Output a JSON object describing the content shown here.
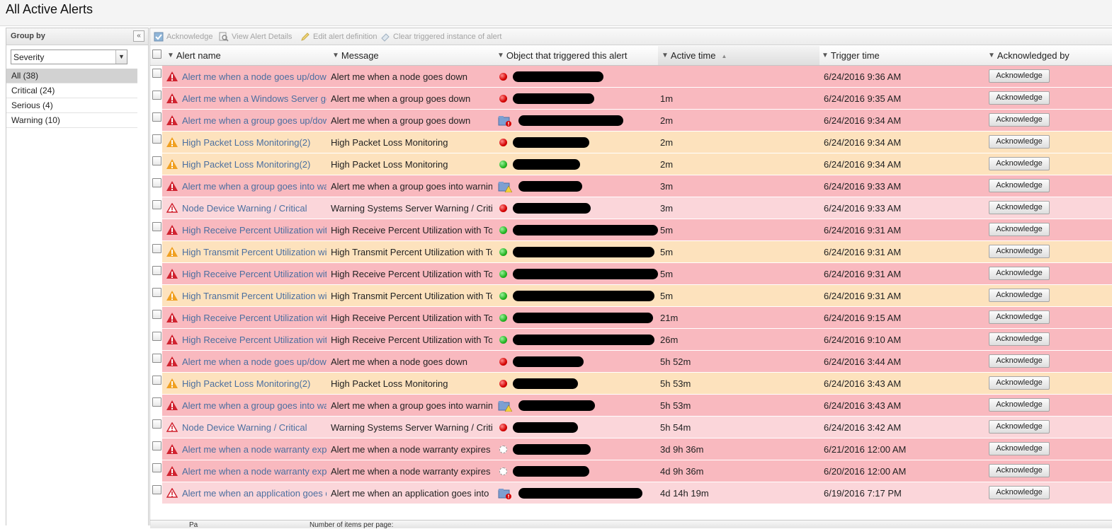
{
  "page": {
    "title": "All Active Alerts"
  },
  "sidebar": {
    "header": "Group by",
    "collapse_icon": "«",
    "group_select": {
      "value": "Severity"
    },
    "groups": [
      {
        "label": "All (38)",
        "selected": true
      },
      {
        "label": "Critical (24)",
        "selected": false
      },
      {
        "label": "Serious (4)",
        "selected": false
      },
      {
        "label": "Warning (10)",
        "selected": false
      }
    ]
  },
  "toolbar": {
    "acknowledge": "Acknowledge",
    "view_details": "View Alert Details",
    "edit_definition": "Edit alert definition",
    "clear_instance": "Clear triggered instance of alert"
  },
  "columns": {
    "alert_name": "Alert name",
    "message": "Message",
    "object": "Object that triggered this alert",
    "active_time": "Active time",
    "trigger_time": "Trigger time",
    "acknowledged_by": "Acknowledged by"
  },
  "colors": {
    "critical_row": "#f9b9bf",
    "serious_row": "#fde2bd",
    "warning_row": "#fbd6da",
    "link": "#4b6fa0"
  },
  "ack_label": "Acknowledge",
  "rows": [
    {
      "sev": "critical",
      "name": "Alert me when a node goes up/down",
      "message": "Alert me when a node goes down",
      "obj": "dot-red",
      "active": "",
      "trigger": "6/24/2016 9:36 AM"
    },
    {
      "sev": "critical",
      "name": "Alert me when a Windows Server goes down",
      "message": "Alert me when a group goes down",
      "obj": "dot-red",
      "active": "1m",
      "trigger": "6/24/2016 9:35 AM"
    },
    {
      "sev": "critical",
      "name": "Alert me when a group goes up/down",
      "message": "Alert me when a group goes down",
      "obj": "group-red",
      "active": "2m",
      "trigger": "6/24/2016 9:34 AM"
    },
    {
      "sev": "serious",
      "name": "High Packet Loss Monitoring(2)",
      "message": "High Packet Loss Monitoring",
      "obj": "dot-red",
      "active": "2m",
      "trigger": "6/24/2016 9:34 AM"
    },
    {
      "sev": "serious",
      "name": "High Packet Loss Monitoring(2)",
      "message": "High Packet Loss Monitoring",
      "obj": "dot-green",
      "active": "2m",
      "trigger": "6/24/2016 9:34 AM"
    },
    {
      "sev": "critical",
      "name": "Alert me when a group goes into warning",
      "message": "Alert me when a group goes into warning",
      "obj": "group-warn",
      "active": "3m",
      "trigger": "6/24/2016 9:33 AM"
    },
    {
      "sev": "warning",
      "name": "Node Device Warning / Critical",
      "message": "Warning Systems Server Warning / Critical",
      "obj": "dot-red",
      "active": "3m",
      "trigger": "6/24/2016 9:33 AM"
    },
    {
      "sev": "critical",
      "name": "High Receive Percent Utilization with Top",
      "message": "High Receive Percent Utilization with Top",
      "obj": "dot-green",
      "active": "5m",
      "trigger": "6/24/2016 9:31 AM"
    },
    {
      "sev": "serious",
      "name": "High Transmit Percent Utilization with Top",
      "message": "High Transmit Percent Utilization with Top",
      "obj": "dot-green",
      "active": "5m",
      "trigger": "6/24/2016 9:31 AM"
    },
    {
      "sev": "critical",
      "name": "High Receive Percent Utilization with Top",
      "message": "High Receive Percent Utilization with Top",
      "obj": "dot-green",
      "active": "5m",
      "trigger": "6/24/2016 9:31 AM"
    },
    {
      "sev": "serious",
      "name": "High Transmit Percent Utilization with Top",
      "message": "High Transmit Percent Utilization with Top",
      "obj": "dot-green",
      "active": "5m",
      "trigger": "6/24/2016 9:31 AM"
    },
    {
      "sev": "critical",
      "name": "High Receive Percent Utilization with Top",
      "message": "High Receive Percent Utilization with Top",
      "obj": "dot-green",
      "active": "21m",
      "trigger": "6/24/2016 9:15 AM"
    },
    {
      "sev": "critical",
      "name": "High Receive Percent Utilization with Top",
      "message": "High Receive Percent Utilization with Top",
      "obj": "dot-green",
      "active": "26m",
      "trigger": "6/24/2016 9:10 AM"
    },
    {
      "sev": "critical",
      "name": "Alert me when a node goes up/down",
      "message": "Alert me when a node goes down",
      "obj": "dot-red",
      "active": "5h 52m",
      "trigger": "6/24/2016 3:44 AM"
    },
    {
      "sev": "serious",
      "name": "High Packet Loss Monitoring(2)",
      "message": "High Packet Loss Monitoring",
      "obj": "dot-red",
      "active": "5h 53m",
      "trigger": "6/24/2016 3:43 AM"
    },
    {
      "sev": "critical",
      "name": "Alert me when a group goes into warning",
      "message": "Alert me when a group goes into warning",
      "obj": "group-warn",
      "active": "5h 53m",
      "trigger": "6/24/2016 3:43 AM"
    },
    {
      "sev": "warning",
      "name": "Node Device Warning / Critical",
      "message": "Warning Systems Server Warning / Critical",
      "obj": "dot-red",
      "active": "5h 54m",
      "trigger": "6/24/2016 3:42 AM"
    },
    {
      "sev": "critical",
      "name": "Alert me when a node warranty expires",
      "message": "Alert me when a node warranty expires",
      "obj": "dot-empty",
      "active": "3d 9h 36m",
      "trigger": "6/21/2016 12:00 AM"
    },
    {
      "sev": "critical",
      "name": "Alert me when a node warranty expires",
      "message": "Alert me when a node warranty expires",
      "obj": "dot-empty",
      "active": "4d 9h 36m",
      "trigger": "6/20/2016 12:00 AM"
    },
    {
      "sev": "warning",
      "name": "Alert me when an application goes down",
      "message": "Alert me when an application goes into",
      "obj": "group-red",
      "active": "4d 14h 19m",
      "trigger": "6/19/2016 7:17 PM"
    }
  ],
  "pager": {
    "page_label": "Pa",
    "items_per_page_label": "Number of items per page:"
  }
}
